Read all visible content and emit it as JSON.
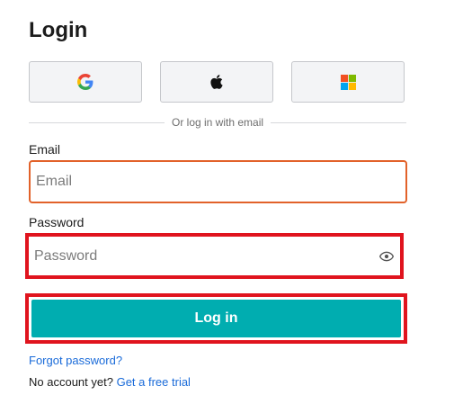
{
  "page": {
    "title": "Login"
  },
  "sso": {
    "google_icon": "google-g-icon",
    "apple_icon": "apple-icon",
    "microsoft_icon": "microsoft-icon"
  },
  "divider_text": "Or log in with email",
  "email": {
    "label": "Email",
    "placeholder": "Email",
    "value": ""
  },
  "password": {
    "label": "Password",
    "placeholder": "Password",
    "value": "",
    "toggle_icon": "eye-icon"
  },
  "login_button": "Log in",
  "forgot_password": "Forgot password?",
  "signup": {
    "prompt": "No account yet?",
    "link": "Get a free trial"
  },
  "colors": {
    "accent": "#00adb0",
    "link": "#1a6bd9",
    "focus_border": "#e2622a",
    "highlight": "#e0141e",
    "button_bg": "#f3f4f6"
  }
}
